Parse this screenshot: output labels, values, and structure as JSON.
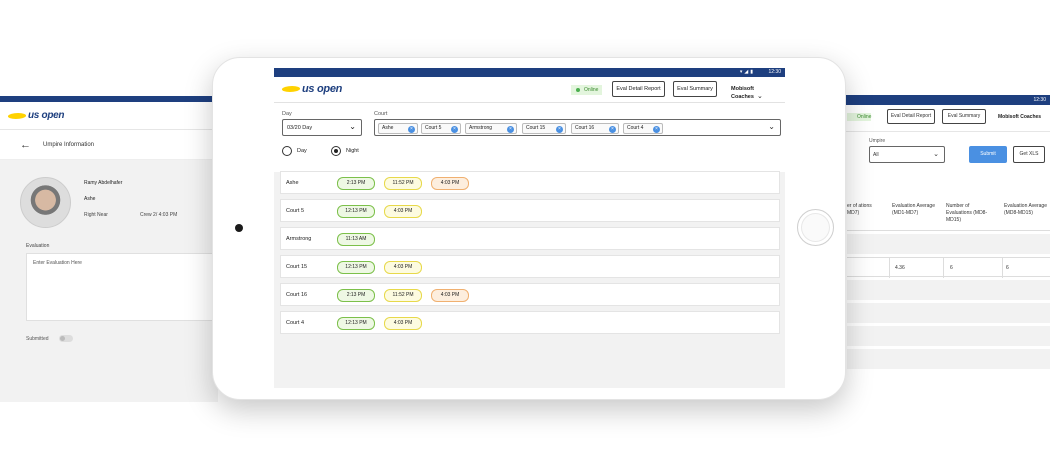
{
  "left_screen": {
    "logo_text": "us open",
    "title": "Umpire Information",
    "person": {
      "name": "Ramy Abdelhafer",
      "court": "Ashe",
      "role": "Right Near",
      "crew": "Crew 2/ 4:03 PM"
    },
    "evaluation_label": "Evaluation",
    "evaluation_placeholder": "Enter Evaluation Here",
    "submitted_label": "Submitted"
  },
  "main": {
    "status_time": "12:30",
    "logo_text": "us open",
    "online_label": "Online",
    "eval_detail_button": "Eval Detail Report",
    "eval_summary_button": "Eval Summary",
    "coach_menu": "Mobisoft Coaches",
    "day_label": "Day",
    "day_value": "03/20 Day",
    "court_label": "Court",
    "selected_courts": [
      "Ashe",
      "Court 5",
      "Armstrong",
      "Court 15",
      "Court 16",
      "Court 4"
    ],
    "radio_day": "Day",
    "radio_night": "Night",
    "schedule": [
      {
        "court": "Ashe",
        "times": [
          {
            "t": "2:13 PM",
            "s": "green"
          },
          {
            "t": "11:52 PM",
            "s": "yellow"
          },
          {
            "t": "4:03 PM",
            "s": "orange"
          }
        ]
      },
      {
        "court": "Court 5",
        "times": [
          {
            "t": "12:13 PM",
            "s": "green"
          },
          {
            "t": "4:03 PM",
            "s": "yellow"
          }
        ]
      },
      {
        "court": "Armstrong",
        "times": [
          {
            "t": "11:13 AM",
            "s": "green"
          }
        ]
      },
      {
        "court": "Court 15",
        "times": [
          {
            "t": "12:13 PM",
            "s": "green"
          },
          {
            "t": "4:03 PM",
            "s": "yellow"
          }
        ]
      },
      {
        "court": "Court 16",
        "times": [
          {
            "t": "2:13 PM",
            "s": "green"
          },
          {
            "t": "11:52 PM",
            "s": "yellow"
          },
          {
            "t": "4:03 PM",
            "s": "orange"
          }
        ]
      },
      {
        "court": "Court 4",
        "times": [
          {
            "t": "12:13 PM",
            "s": "green"
          },
          {
            "t": "4:03 PM",
            "s": "yellow"
          }
        ]
      }
    ]
  },
  "right_screen": {
    "status_time": "12:30",
    "online_label": "Online",
    "eval_detail_button": "Eval Detail Report",
    "eval_summary_button": "Eval Summary",
    "coach_menu": "Mobisoft Coaches",
    "umpire_label": "Umpire",
    "umpire_value": "All",
    "submit_button": "Submit",
    "get_xls_button": "Get XLS",
    "columns": [
      "er of ations MD7)",
      "Evaluation Average (MD1-MD7)",
      "Number of Evaluations (MD8-MD15)",
      "Evaluation Average (MD8-MD15)"
    ],
    "row": [
      "",
      "4.36",
      "6",
      "6"
    ]
  },
  "colors": {
    "brand_navy": "#1e3f7f",
    "brand_yellow": "#ffd200",
    "accent_blue": "#4a90e2",
    "pill_green": "#7cc04a",
    "pill_yellow": "#e7d94a",
    "pill_orange": "#f0b070"
  }
}
